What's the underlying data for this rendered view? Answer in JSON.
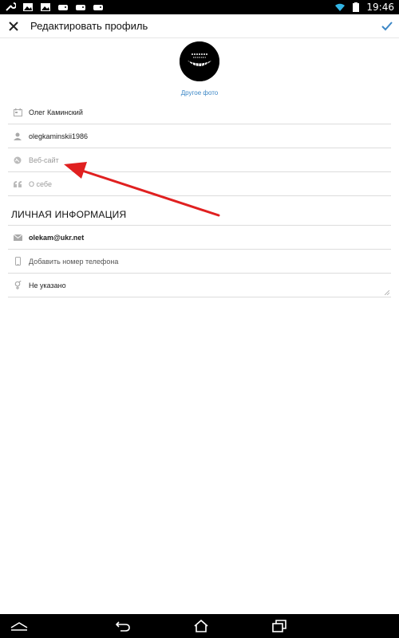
{
  "status_bar": {
    "time": "19:46",
    "left_icons": [
      "wrench-icon",
      "image-icon",
      "image-icon",
      "gamepad-icon",
      "gamepad-icon",
      "gamepad-icon"
    ],
    "right_icons": [
      "wifi-icon",
      "battery-icon"
    ]
  },
  "appbar": {
    "title": "Редактировать профиль",
    "close_icon": "close-icon",
    "confirm_icon": "checkmark-icon",
    "accent_color": "#3c87c6"
  },
  "profile": {
    "change_photo_label": "Другое фото"
  },
  "fields": [
    {
      "name": "name-field",
      "icon": "id-card-icon",
      "value": "Олег Каминский",
      "placeholder": false
    },
    {
      "name": "username-field",
      "icon": "person-icon",
      "value": "olegkaminskii1986",
      "placeholder": false
    },
    {
      "name": "website-field",
      "icon": "globe-icon",
      "value": "Веб-сайт",
      "placeholder": true
    },
    {
      "name": "bio-field",
      "icon": "quote-icon",
      "value": "О себе",
      "placeholder": true
    }
  ],
  "personal_section": {
    "title": "ЛИЧНАЯ ИНФОРМАЦИЯ",
    "fields": [
      {
        "name": "email-field",
        "icon": "envelope-icon",
        "value": "olekam@ukr.net",
        "bold": true
      },
      {
        "name": "phone-field",
        "icon": "phone-icon",
        "value": "Добавить номер телефона",
        "bold": false
      },
      {
        "name": "gender-field",
        "icon": "gender-icon",
        "value": "Не указано",
        "bold": false
      }
    ]
  },
  "annotation": {
    "arrow_color": "#e02020"
  },
  "nav_bar": {
    "icons": [
      "collapse-icon",
      "back-icon",
      "home-icon",
      "recent-apps-icon"
    ]
  }
}
